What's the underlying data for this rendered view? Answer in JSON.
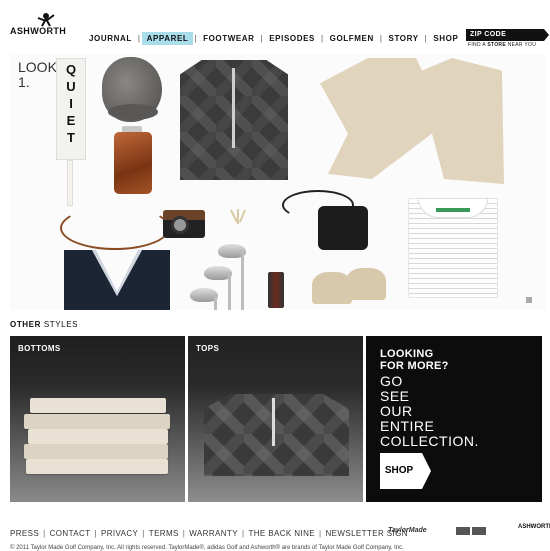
{
  "header": {
    "logo_text": "ASHWORTH",
    "nav": [
      {
        "label": "JOURNAL",
        "active": false
      },
      {
        "label": "APPAREL",
        "active": true
      },
      {
        "label": "FOOTWEAR",
        "active": false
      },
      {
        "label": "EPISODES",
        "active": false
      },
      {
        "label": "GOLFMEN",
        "active": false
      },
      {
        "label": "STORY",
        "active": false
      },
      {
        "label": "SHOP",
        "active": false
      }
    ],
    "zip_label": "ZIP CODE",
    "find_prefix": "FIND A",
    "find_bold": "STORE",
    "find_suffix": "NEAR YOU"
  },
  "hero": {
    "look_label": "LOOK",
    "look_number": "1.",
    "tag_text": "QUIET"
  },
  "other_styles": {
    "bold": "OTHER",
    "rest": " STYLES"
  },
  "panels": {
    "bottoms_label": "BOTTOMS",
    "tops_label": "TOPS",
    "more_heading_1": "LOOKING",
    "more_heading_2": "FOR MORE?",
    "more_lines": [
      "GO",
      "SEE",
      "OUR",
      "ENTIRE",
      "COLLECTION."
    ],
    "shop_label": "SHOP"
  },
  "footer": {
    "links": [
      "PRESS",
      "CONTACT",
      "PRIVACY",
      "TERMS",
      "WARRANTY",
      "THE BACK NINE",
      "NEWSLETTER SIGN"
    ],
    "taylormade": "TaylorMade",
    "ashworth_small": "ASHWORTH",
    "copyright": "© 2011 Taylor Made Golf Company, Inc. All rights reserved. TaylorMade®, adidas Golf and Ashworth® are brands of Taylor Made Golf Company, Inc."
  },
  "colors": {
    "nav_active_bg": "#a9dde9",
    "zip_bg": "#111111",
    "more_panel_bg": "#0c0c0c"
  }
}
